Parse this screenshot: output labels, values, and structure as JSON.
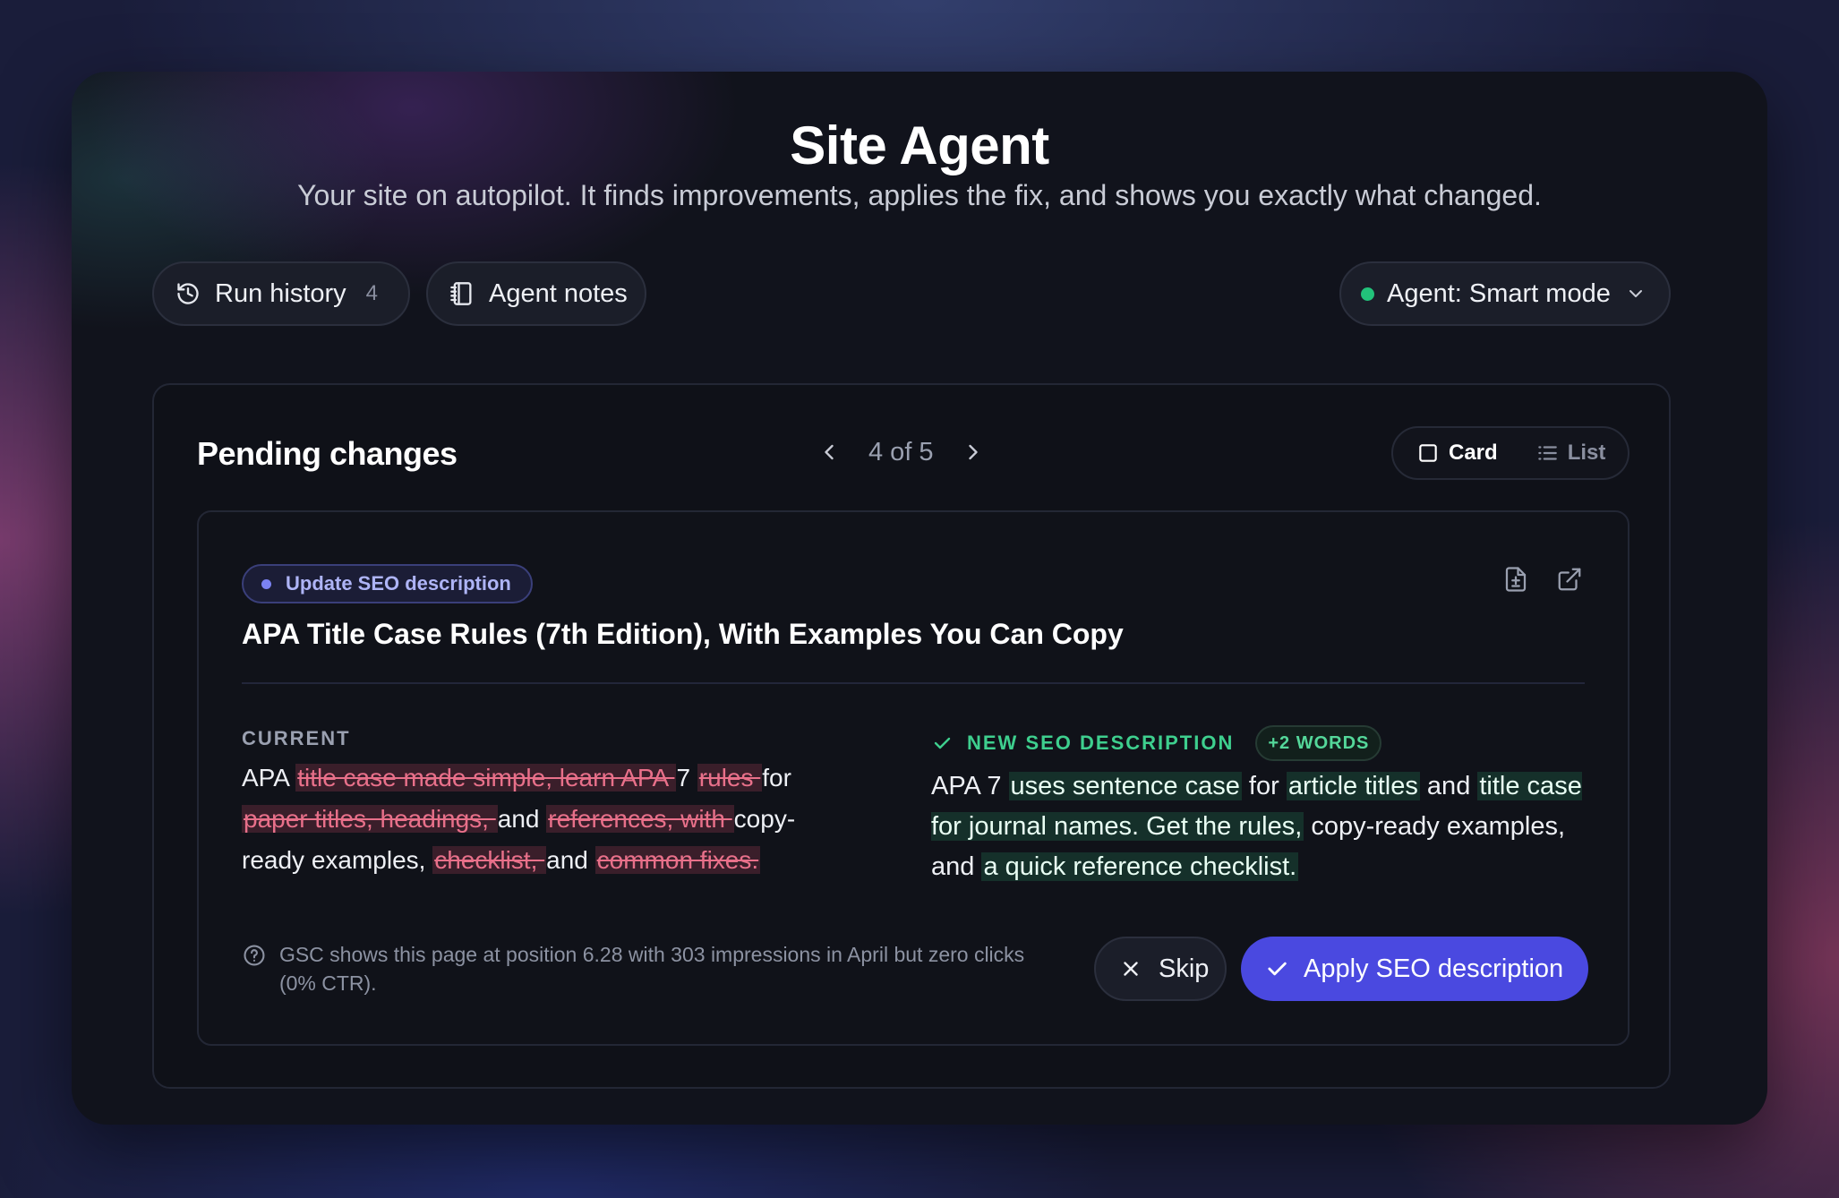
{
  "header": {
    "title": "Site Agent",
    "subtitle": "Your site on autopilot. It finds improvements, applies the fix, and shows you exactly what changed."
  },
  "toolbar": {
    "run_history_label": "Run history",
    "run_history_count": "4",
    "agent_notes_label": "Agent notes",
    "agent_mode_label": "Agent: Smart mode"
  },
  "pending": {
    "title": "Pending changes",
    "pager_text": "4 of 5",
    "view_card_label": "Card",
    "view_list_label": "List"
  },
  "change": {
    "type_badge": "Update SEO description",
    "page_title": "APA Title Case Rules (7th Edition), With Examples You Can Copy",
    "current_label": "CURRENT",
    "current_segments": [
      {
        "t": "APA ",
        "op": "keep"
      },
      {
        "t": "title case made simple, learn APA ",
        "op": "del"
      },
      {
        "t": " 7 ",
        "op": "keep"
      },
      {
        "t": "rules ",
        "op": "del"
      },
      {
        "t": " for ",
        "op": "keep"
      },
      {
        "t": "paper titles, headings, ",
        "op": "del"
      },
      {
        "t": " and ",
        "op": "keep"
      },
      {
        "t": "references, with ",
        "op": "del"
      },
      {
        "t": " copy-ready examples, ",
        "op": "keep"
      },
      {
        "t": "checklist, ",
        "op": "del"
      },
      {
        "t": " and ",
        "op": "keep"
      },
      {
        "t": "common fixes.",
        "op": "del"
      }
    ],
    "new_label": "NEW SEO DESCRIPTION",
    "words_delta": "+2 WORDS",
    "new_segments": [
      {
        "t": "APA 7 ",
        "op": "keep"
      },
      {
        "t": "uses sentence case",
        "op": "ins"
      },
      {
        "t": " for ",
        "op": "keep"
      },
      {
        "t": "article titles",
        "op": "ins"
      },
      {
        "t": " and ",
        "op": "keep"
      },
      {
        "t": "title case for journal names. Get the rules,",
        "op": "ins"
      },
      {
        "t": " copy-ready examples, and ",
        "op": "keep"
      },
      {
        "t": "a quick reference checklist.",
        "op": "ins"
      }
    ],
    "reason": "GSC shows this page at position 6.28 with 303 impressions in April but zero clicks (0% CTR).",
    "skip_label": "Skip",
    "apply_label": "Apply SEO description"
  },
  "colors": {
    "accent": "#4a49e0",
    "status_green": "#22c27a",
    "deleted_text": "#e8708a",
    "inserted_bg": "#15302a"
  },
  "icons": [
    "history-icon",
    "notebook-icon",
    "status-dot",
    "chevron-down-icon",
    "chevron-left-icon",
    "chevron-right-icon",
    "card-view-icon",
    "list-view-icon",
    "file-diff-icon",
    "external-link-icon",
    "check-icon",
    "help-circle-icon",
    "close-icon"
  ]
}
